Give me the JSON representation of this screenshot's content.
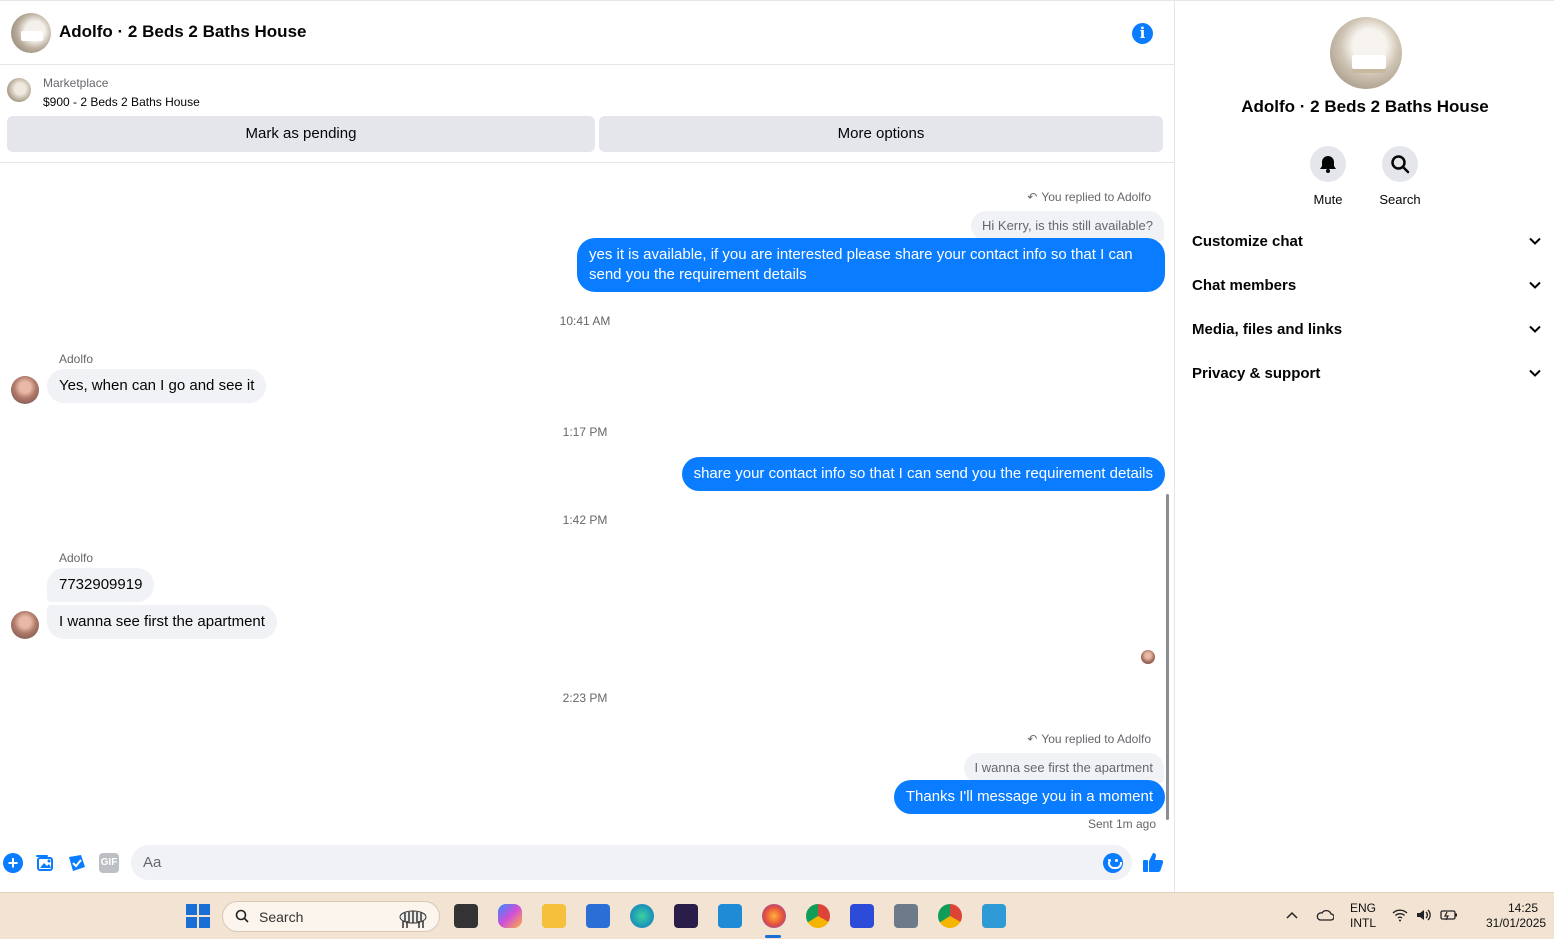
{
  "header": {
    "title": "Adolfo · 2 Beds 2 Baths House"
  },
  "listing": {
    "label": "Marketplace",
    "price_title": "$900 - 2 Beds 2 Baths House",
    "mark_pending": "Mark as pending",
    "more_options": "More options"
  },
  "thread": {
    "reply1_hint": "You replied to Adolfo",
    "reply1_quote": "Hi Kerry, is this still available?",
    "out1": "yes it is available, if you are interested please share your contact info so that I can send you the requirement details",
    "time1": "10:41 AM",
    "sender1": "Adolfo",
    "in1": "Yes, when can I go and see it",
    "time2": "1:17 PM",
    "out2": "share your contact info so that I can send you the requirement details",
    "time3": "1:42 PM",
    "sender2": "Adolfo",
    "in2": "7732909919",
    "in3": "I wanna see first the apartment",
    "time4": "2:23 PM",
    "reply2_hint": "You replied to Adolfo",
    "reply2_quote": "I wanna see first the apartment",
    "out3": "Thanks I'll message you in a moment",
    "sent_status": "Sent 1m ago"
  },
  "composer": {
    "placeholder": "Aa",
    "gif_label": "GIF"
  },
  "sidebar": {
    "title": "Adolfo · 2 Beds 2 Baths House",
    "mute_label": "Mute",
    "search_label": "Search",
    "sections": [
      "Customize chat",
      "Chat members",
      "Media, files and links",
      "Privacy & support"
    ]
  },
  "taskbar": {
    "search_label": "Search",
    "lang_top": "ENG",
    "lang_bottom": "INTL",
    "time": "14:25",
    "date": "31/01/2025"
  },
  "colors": {
    "accent": "#0a7cff",
    "bubble_in": "#f0f2f5",
    "taskbar": "#f3e3d3"
  }
}
